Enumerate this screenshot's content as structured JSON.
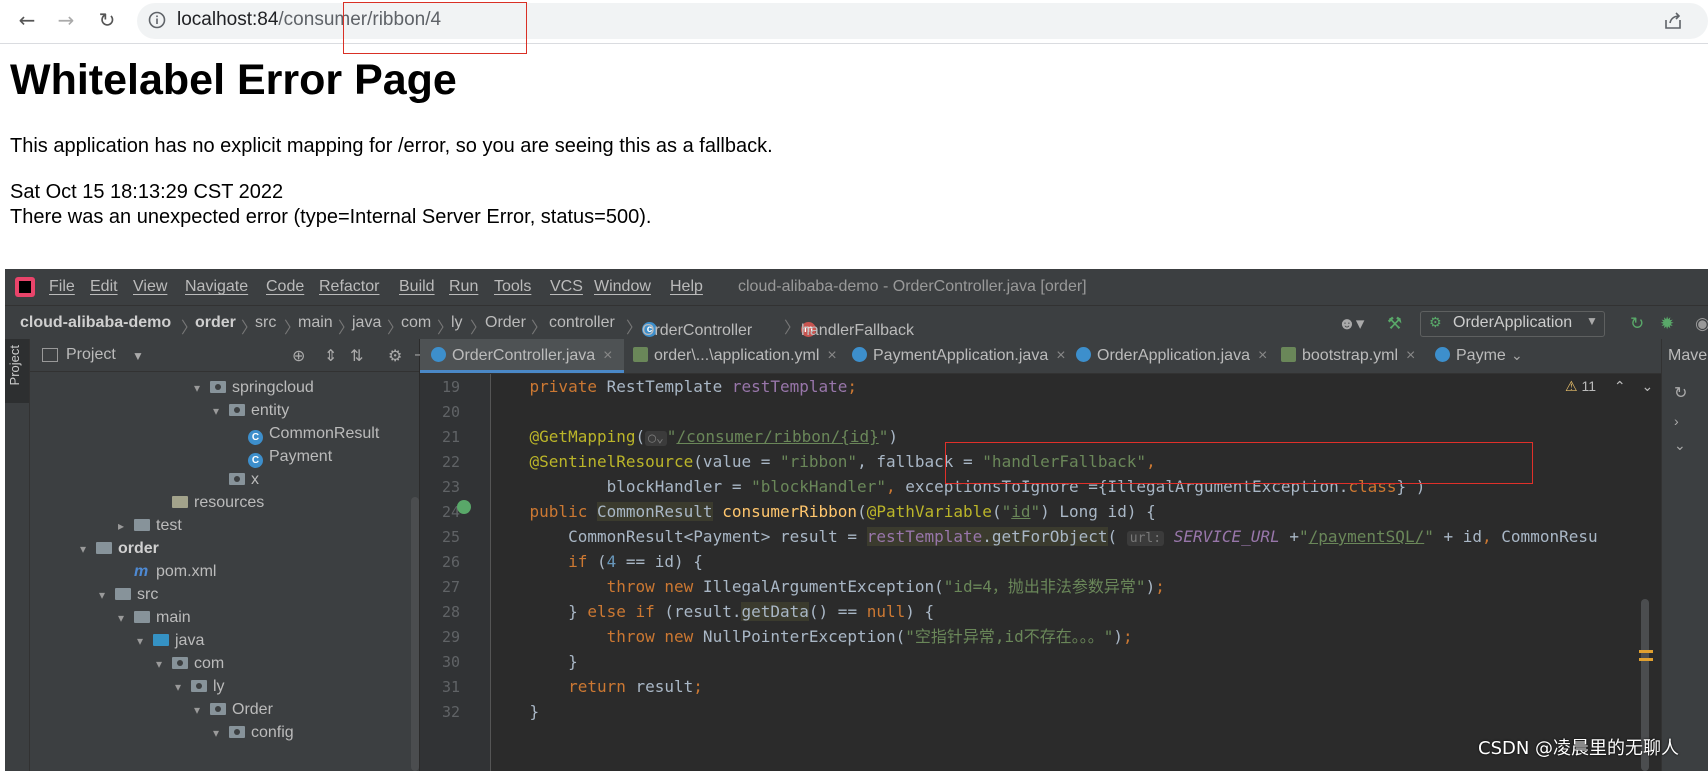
{
  "browser": {
    "url_host": "localhost:84",
    "url_path": "/consumer/ribbon/4",
    "back_icon": "back-arrow-icon",
    "forward_icon": "forward-arrow-icon",
    "reload_icon": "reload-icon",
    "info_icon": "site-info-icon",
    "share_icon": "share-icon"
  },
  "error_page": {
    "title": "Whitelabel Error Page",
    "message": "This application has no explicit mapping for /error, so you are seeing this as a fallback.",
    "timestamp": "Sat Oct 15 18:13:29 CST 2022",
    "detail": "There was an unexpected error (type=Internal Server Error, status=500)."
  },
  "ide": {
    "menu": [
      "File",
      "Edit",
      "View",
      "Navigate",
      "Code",
      "Refactor",
      "Build",
      "Run",
      "Tools",
      "VCS",
      "Window",
      "Help"
    ],
    "window_title": "cloud-alibaba-demo - OrderController.java [order]",
    "breadcrumbs": [
      "cloud-alibaba-demo",
      "order",
      "src",
      "main",
      "java",
      "com",
      "ly",
      "Order",
      "controller",
      "OrderController",
      "handlerFallback"
    ],
    "run_config": "OrderApplication",
    "project_panel": {
      "title": "Project",
      "side_tab": "Project",
      "tree": [
        {
          "label": "springcloud",
          "kind": "pkg",
          "indent": 8,
          "arrow": "▾"
        },
        {
          "label": "entity",
          "kind": "pkg",
          "indent": 9,
          "arrow": "▾"
        },
        {
          "label": "CommonResult",
          "kind": "class",
          "indent": 10,
          "arrow": ""
        },
        {
          "label": "Payment",
          "kind": "class",
          "indent": 10,
          "arrow": ""
        },
        {
          "label": "x",
          "kind": "pkg",
          "indent": 9,
          "arrow": ""
        },
        {
          "label": "resources",
          "kind": "res",
          "indent": 6,
          "arrow": ""
        },
        {
          "label": "test",
          "kind": "folder",
          "indent": 4,
          "arrow": "▸"
        },
        {
          "label": "order",
          "kind": "module",
          "indent": 2,
          "arrow": "▾"
        },
        {
          "label": "pom.xml",
          "kind": "maven",
          "indent": 4,
          "arrow": ""
        },
        {
          "label": "src",
          "kind": "folder",
          "indent": 3,
          "arrow": "▾"
        },
        {
          "label": "main",
          "kind": "folder",
          "indent": 4,
          "arrow": "▾"
        },
        {
          "label": "java",
          "kind": "blue",
          "indent": 5,
          "arrow": "▾"
        },
        {
          "label": "com",
          "kind": "pkg",
          "indent": 6,
          "arrow": "▾"
        },
        {
          "label": "ly",
          "kind": "pkg",
          "indent": 7,
          "arrow": "▾"
        },
        {
          "label": "Order",
          "kind": "pkg",
          "indent": 8,
          "arrow": "▾"
        },
        {
          "label": "config",
          "kind": "pkg",
          "indent": 9,
          "arrow": "▾"
        }
      ]
    },
    "tabs": [
      {
        "label": "OrderController.java",
        "active": true
      },
      {
        "label": "order\\...\\application.yml",
        "active": false
      },
      {
        "label": "PaymentApplication.java",
        "active": false
      },
      {
        "label": "OrderApplication.java",
        "active": false
      },
      {
        "label": "bootstrap.yml",
        "active": false
      },
      {
        "label": "Payme",
        "active": false
      }
    ],
    "right_tab": "Maven",
    "warning_count": "11",
    "line_numbers": [
      "19",
      "20",
      "21",
      "22",
      "23",
      "24",
      "25",
      "26",
      "27",
      "28",
      "29",
      "30",
      "31",
      "32"
    ],
    "code_lines": [
      "    private RestTemplate restTemplate;",
      "",
      "    @GetMapping(\"/consumer/ribbon/{id}\")",
      "    @SentinelResource(value = \"ribbon\", fallback = \"handlerFallback\",",
      "            blockHandler = \"blockHandler\", exceptionsToIgnore ={IllegalArgumentException.class} )",
      "    public CommonResult consumerRibbon(@PathVariable(\"id\") Long id) {",
      "        CommonResult<Payment> result = restTemplate.getForObject( url: SERVICE_URL +\"/paymentSQL/\" + id, CommonResu",
      "        if (4 == id) {",
      "            throw new IllegalArgumentException(\"id=4，抛出非法参数异常\");",
      "        } else if (result.getData() == null) {",
      "            throw new NullPointerException(\"空指针异常,id不存在。。。\");",
      "        }",
      "        return result;",
      "    }"
    ]
  },
  "watermark": "CSDN @凌晨里的无聊人"
}
